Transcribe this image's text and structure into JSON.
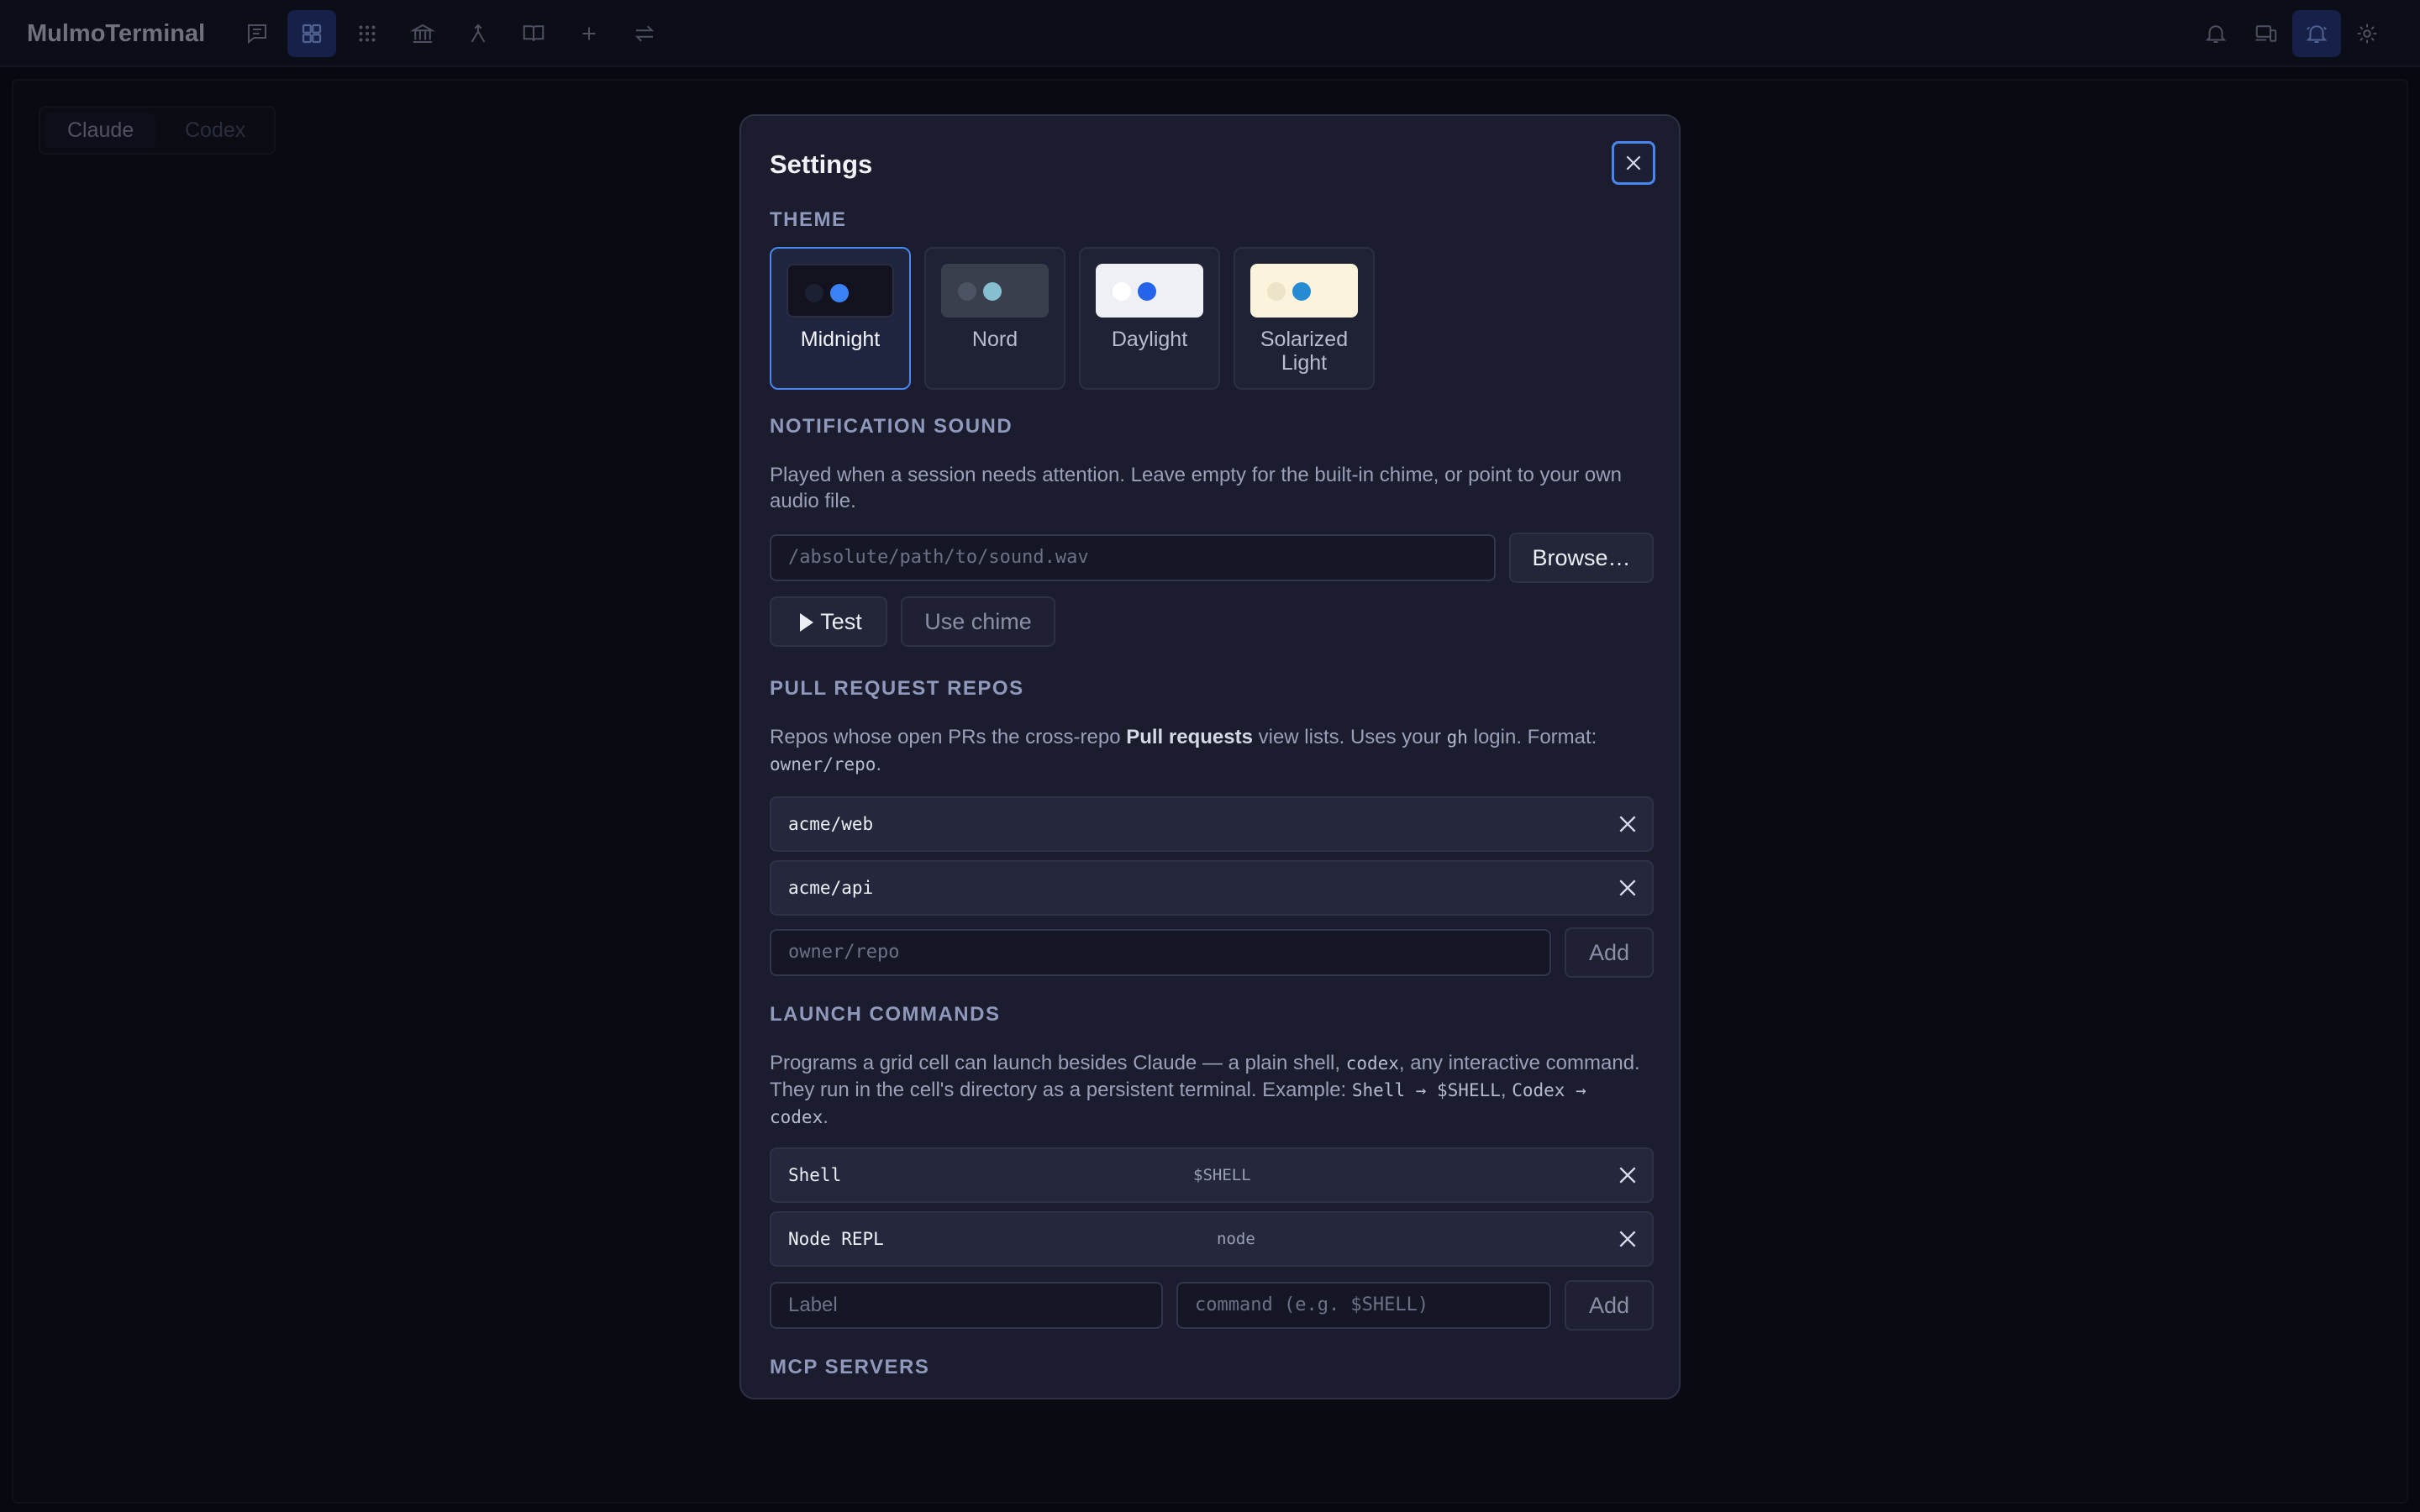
{
  "app": {
    "title": "MulmoTerminal"
  },
  "background": {
    "tabs": [
      "Claude",
      "Codex"
    ]
  },
  "settings": {
    "title": "Settings",
    "theme": {
      "heading": "THEME",
      "options": [
        {
          "label": "Midnight",
          "selected": true
        },
        {
          "label": "Nord",
          "selected": false
        },
        {
          "label": "Daylight",
          "selected": false
        },
        {
          "label": "Solarized Light",
          "selected": false
        }
      ]
    },
    "notification": {
      "heading": "NOTIFICATION SOUND",
      "description": "Played when a session needs attention. Leave empty for the built-in chime, or point to your own audio file.",
      "path_placeholder": "/absolute/path/to/sound.wav",
      "browse_label": "Browse…",
      "test_label": "Test",
      "chime_label": "Use chime"
    },
    "pr_repos": {
      "heading": "PULL REQUEST REPOS",
      "desc_a": "Repos whose open PRs the cross-repo ",
      "desc_bold": "Pull requests",
      "desc_b": " view lists. Uses your ",
      "desc_code1": "gh",
      "desc_c": " login. Format: ",
      "desc_code2": "owner/repo",
      "desc_d": ".",
      "items": [
        "acme/web",
        "acme/api"
      ],
      "input_placeholder": "owner/repo",
      "add_label": "Add"
    },
    "launch": {
      "heading": "LAUNCH COMMANDS",
      "desc_a": "Programs a grid cell can launch besides Claude — a plain shell, ",
      "desc_code1": "codex",
      "desc_b": ", any interactive command. They run in the cell's directory as a persistent terminal. Example: ",
      "desc_code2": "Shell → $SHELL",
      "desc_c": ", ",
      "desc_code3": "Codex → codex",
      "desc_d": ".",
      "items": [
        {
          "label": "Shell",
          "command": "$SHELL"
        },
        {
          "label": "Node REPL",
          "command": "node"
        }
      ],
      "label_placeholder": "Label",
      "command_placeholder": "command (e.g. $SHELL)",
      "add_label": "Add"
    },
    "mcp": {
      "heading": "MCP SERVERS"
    }
  }
}
